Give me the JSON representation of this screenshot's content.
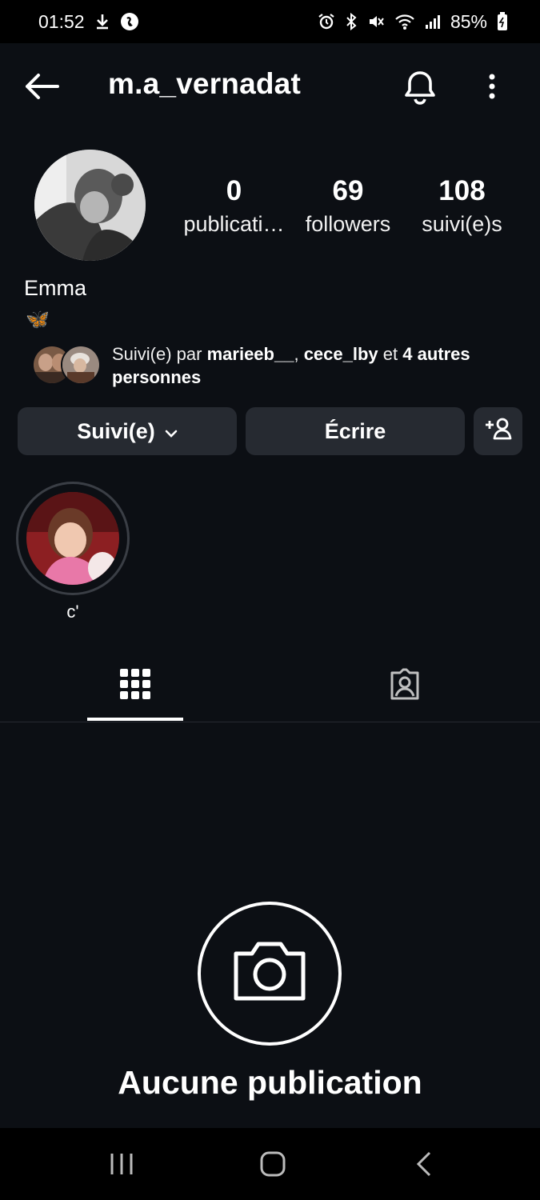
{
  "status_bar": {
    "time": "01:52",
    "battery": "85%",
    "icons": [
      "download-icon",
      "shazam-icon",
      "alarm-icon",
      "bluetooth-icon",
      "mute-icon",
      "wifi-icon",
      "signal-icon",
      "battery-icon"
    ]
  },
  "header": {
    "username": "m.a_vernadat",
    "icons": [
      "back-arrow-icon",
      "bell-icon",
      "more-vertical-icon"
    ]
  },
  "profile": {
    "stats": [
      {
        "value": "0",
        "label": "publicati…"
      },
      {
        "value": "69",
        "label": "followers"
      },
      {
        "value": "108",
        "label": "suivi(e)s"
      }
    ],
    "name": "Emma",
    "bio": "🦋"
  },
  "mutual": {
    "prefix": "Suivi(e) par ",
    "user1": "marieeb__",
    "sep": ", ",
    "user2": "cece_lby",
    "mid": " et ",
    "rest": "4 autres personnes"
  },
  "actions": {
    "follow_label": "Suivi(e)",
    "message_label": "Écrire",
    "add_icon": "add-person-icon"
  },
  "highlights": [
    {
      "label": "c'"
    }
  ],
  "tabs": [
    {
      "icon": "grid-icon",
      "active": true
    },
    {
      "icon": "tagged-icon",
      "active": false
    }
  ],
  "empty_state": {
    "icon": "camera-icon",
    "title": "Aucune publication"
  },
  "nav_bar": {
    "icons": [
      "recents-icon",
      "home-icon",
      "back-icon"
    ]
  },
  "colors": {
    "background": "#0c0f14",
    "button": "#262a31",
    "text": "#ffffff"
  }
}
